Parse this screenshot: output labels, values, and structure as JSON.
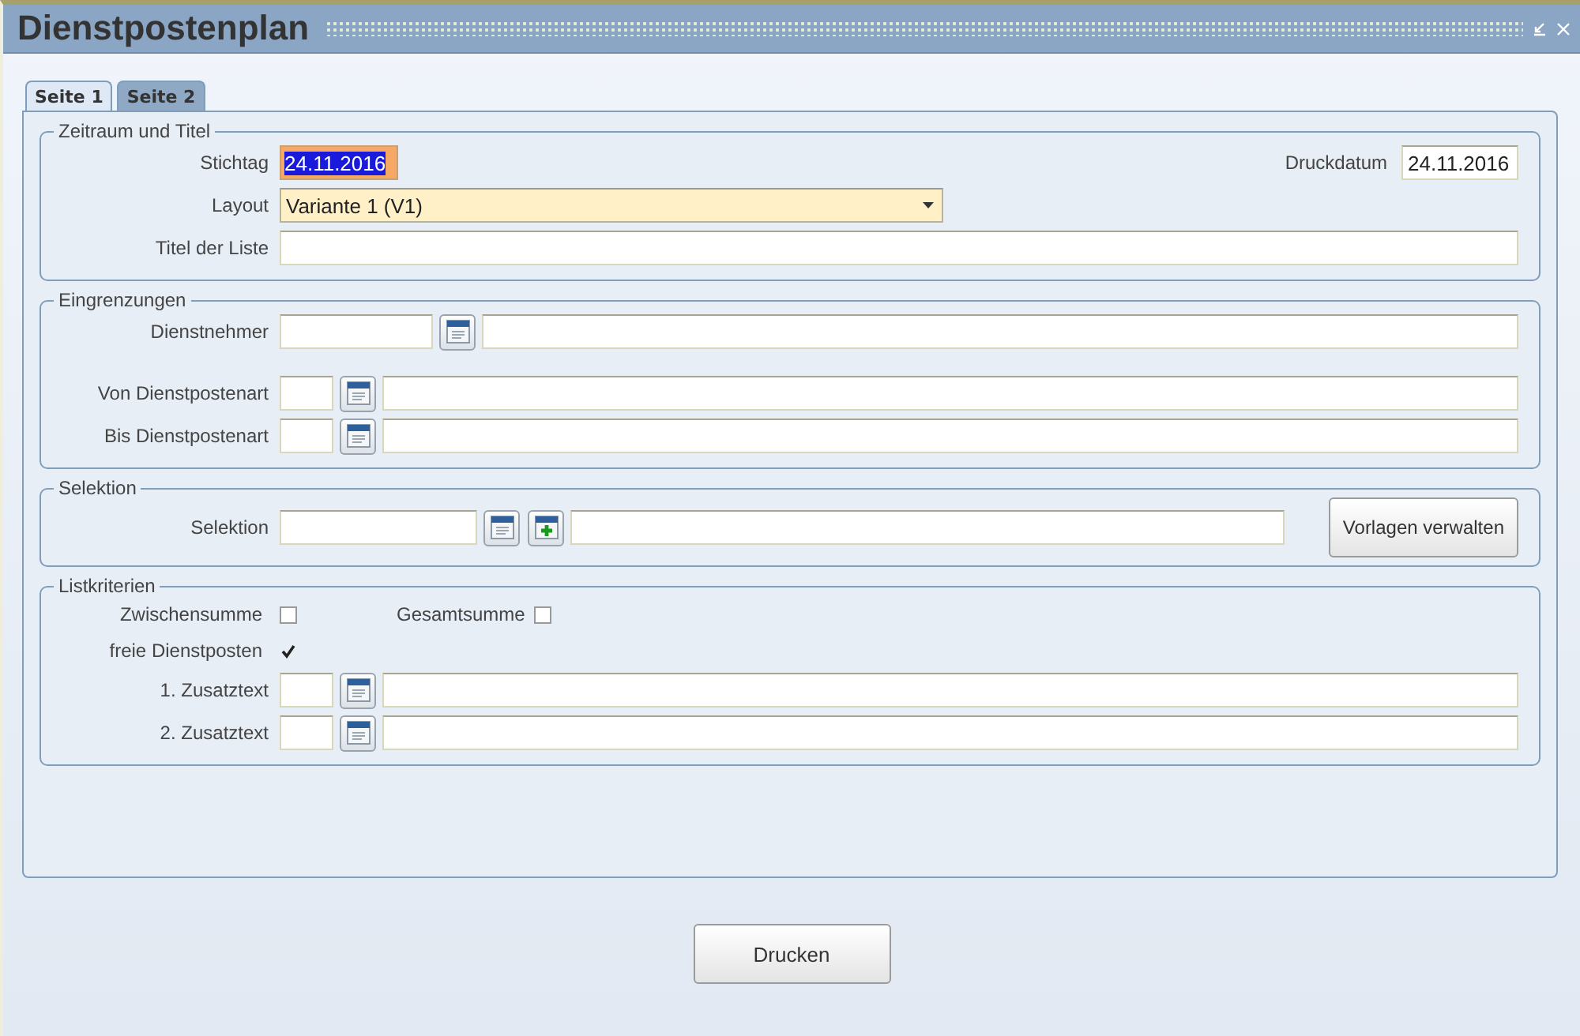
{
  "window": {
    "title": "Dienstpostenplan"
  },
  "tabs": [
    {
      "label": "Seite 1",
      "selected": true
    },
    {
      "label": "Seite 2",
      "selected": false
    }
  ],
  "groups": [
    {
      "title": "Zeitraum und Titel",
      "rows": [
        {
          "kind": "date",
          "label": "Stichtag",
          "value": "24.11.2016",
          "selected": true,
          "aside": {
            "label": "Druckdatum",
            "value": "24.11.2016"
          }
        },
        {
          "kind": "select",
          "label": "Layout",
          "value": "Variante 1 (V1)"
        },
        {
          "kind": "text",
          "label": "Titel der Liste"
        }
      ]
    },
    {
      "title": "Eingrenzungen",
      "rows": [
        {
          "kind": "widelookup",
          "label": "Dienstnehmer"
        },
        {
          "kind": "lookup",
          "label": "Von Dienstpostenart"
        },
        {
          "kind": "lookup",
          "label": "Bis Dienstpostenart"
        }
      ]
    },
    {
      "title": "Selektion",
      "rows": [
        {
          "kind": "selection",
          "label": "Selektion",
          "action": "Vorlagen verwalten"
        }
      ]
    },
    {
      "title": "Listkriterien",
      "rows": [
        {
          "kind": "checks",
          "items": [
            {
              "label": "Zwischensumme",
              "checked": false
            },
            {
              "label": "Gesamtsumme",
              "checked": false
            }
          ]
        },
        {
          "kind": "checks",
          "items": [
            {
              "label": "freie Dienstposten",
              "checked": true
            }
          ]
        },
        {
          "kind": "lookup",
          "label": "1. Zusatztext"
        },
        {
          "kind": "lookup",
          "label": "2. Zusatztext"
        }
      ]
    }
  ],
  "buttons": [
    "Drucken"
  ]
}
